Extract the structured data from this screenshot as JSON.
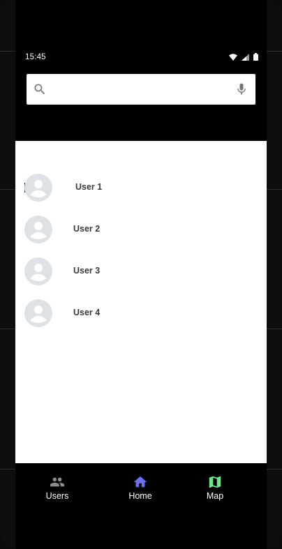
{
  "status_bar": {
    "time": "15:45",
    "icons": [
      "wifi-icon",
      "cellular-signal-icon",
      "battery-icon"
    ]
  },
  "search": {
    "value": "",
    "placeholder": "",
    "left_icon": "search-icon",
    "right_icon": "mic-icon"
  },
  "users": {
    "items": [
      {
        "name": "User 1",
        "avatar_icon": "avatar-placeholder-icon"
      },
      {
        "name": "User 2",
        "avatar_icon": "avatar-placeholder-icon"
      },
      {
        "name": "User 3",
        "avatar_icon": "avatar-placeholder-icon"
      },
      {
        "name": "User 4",
        "avatar_icon": "avatar-placeholder-icon"
      }
    ]
  },
  "bottom_nav": {
    "items": [
      {
        "label": "Users",
        "icon": "people-icon",
        "color": "#8c8c8c"
      },
      {
        "label": "Home",
        "icon": "home-icon",
        "color": "#6b6ff0"
      },
      {
        "label": "Map",
        "icon": "map-icon",
        "color": "#6fe58f"
      }
    ]
  },
  "colors": {
    "background": "#000000",
    "content": "#ffffff",
    "avatar_bg": "#dde2e6",
    "avatar_fg": "#ffffff",
    "user_text": "#3a3a3a"
  }
}
